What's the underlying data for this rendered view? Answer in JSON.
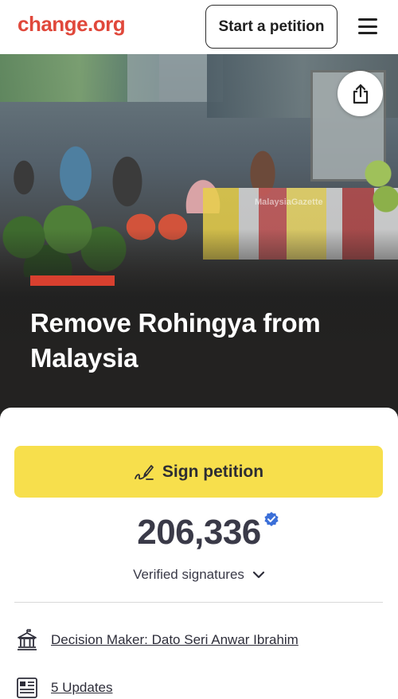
{
  "header": {
    "logo": "change.org",
    "start_petition_label": "Start a petition",
    "menu_icon": "hamburger-menu-icon"
  },
  "hero": {
    "image_watermark": "MalaysiaGazette",
    "share_icon": "share-icon",
    "accent_color": "#d8402f",
    "title": "Remove Rohingya from Malaysia"
  },
  "petition": {
    "sign_label": "Sign petition",
    "sign_icon": "pen-signature-icon",
    "sign_button_color": "#f7df4c",
    "signature_count": "206,336",
    "verified_badge_color": "#3b6fd8",
    "verified_label": "Verified signatures",
    "decision_maker": "Decision Maker: Dato Seri Anwar Ibrahim",
    "updates": "5 Updates"
  }
}
